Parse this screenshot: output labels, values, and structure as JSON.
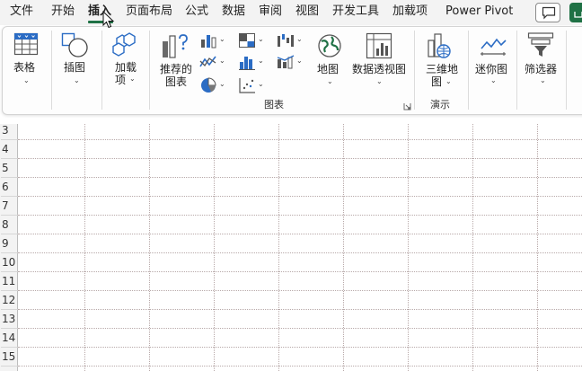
{
  "tabs": [
    {
      "id": "file",
      "label": "文件"
    },
    {
      "id": "home",
      "label": "开始"
    },
    {
      "id": "insert",
      "label": "插入",
      "active": true
    },
    {
      "id": "page-layout",
      "label": "页面布局"
    },
    {
      "id": "formulas",
      "label": "公式"
    },
    {
      "id": "data",
      "label": "数据"
    },
    {
      "id": "review",
      "label": "审阅"
    },
    {
      "id": "view",
      "label": "视图"
    },
    {
      "id": "developer",
      "label": "开发工具"
    },
    {
      "id": "addins",
      "label": "加载项"
    },
    {
      "id": "powerpivot",
      "label": "Power Pivot"
    }
  ],
  "ribbon": {
    "table": {
      "label": "表格"
    },
    "illustrations": {
      "label": "插图"
    },
    "addins": {
      "line1": "加载",
      "line2": "项"
    },
    "recommended_charts": {
      "line1": "推荐的",
      "line2": "图表"
    },
    "maps": {
      "label": "地图"
    },
    "pivot_chart": {
      "label": "数据透视图"
    },
    "map3d": {
      "line1": "三维地",
      "line2": "图"
    },
    "sparklines": {
      "label": "迷你图"
    },
    "filters": {
      "label": "筛选器"
    },
    "groups": {
      "charts": "图表",
      "tours": "演示"
    }
  },
  "rows": [
    "3",
    "4",
    "5",
    "6",
    "7",
    "8",
    "9",
    "10",
    "11",
    "12",
    "13",
    "14",
    "15"
  ],
  "colors": {
    "accent": "#1f7145",
    "icon_blue": "#2b6cc4",
    "icon_gray": "#5a5a5a"
  }
}
